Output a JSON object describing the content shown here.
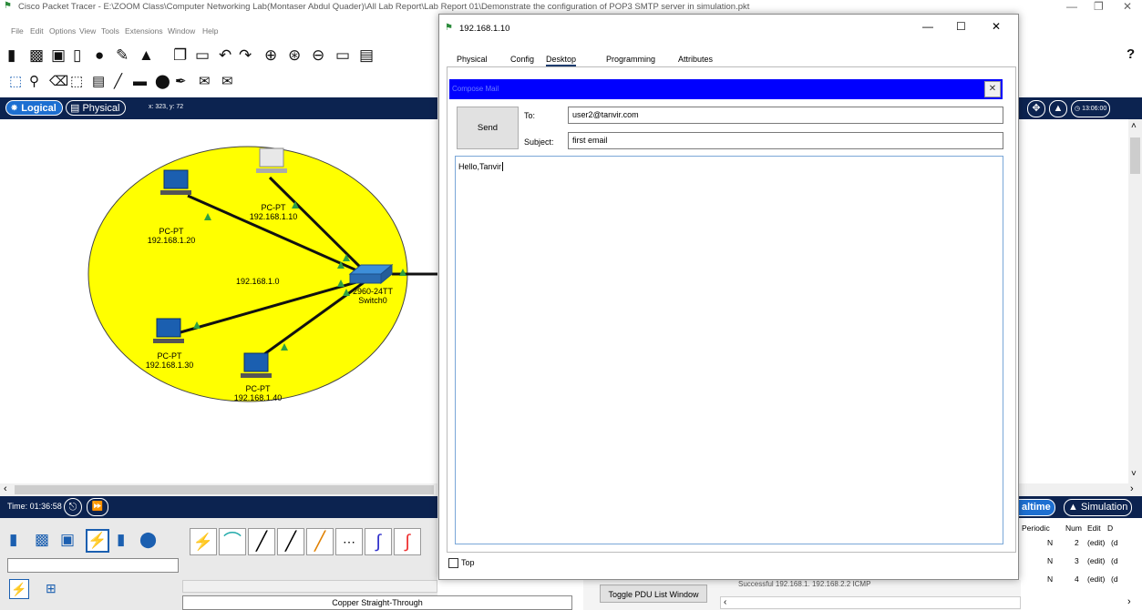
{
  "app": {
    "title": "Cisco Packet Tracer - E:\\ZOOM Class\\Computer Networking Lab(Montaser Abdul Quader)\\All Lab Report\\Lab Report 01\\Demonstrate the configuration of POP3 SMTP server in simulation.pkt",
    "menu": [
      "File",
      "Edit",
      "Options",
      "View",
      "Tools",
      "Extensions",
      "Window",
      "Help"
    ]
  },
  "workspace": {
    "logical_label": "Logical",
    "physical_label": "Physical",
    "coords": "x: 323, y: 72",
    "network_label": "192.168.1.0",
    "devices": [
      {
        "type": "PC-PT",
        "ip": "192.168.1.20"
      },
      {
        "type": "PC-PT",
        "ip": "192.168.1.10"
      },
      {
        "type": "PC-PT",
        "ip": "192.168.1.30"
      },
      {
        "type": "PC-PT",
        "ip": "192.168.1.40"
      }
    ],
    "switch": {
      "model": "2960-24TT",
      "name": "Switch0"
    },
    "clock": "13:06:00"
  },
  "timebar": {
    "time": "Time: 01:36:58"
  },
  "mode": {
    "realtime": "altime",
    "simulation": "Simulation"
  },
  "connections": {
    "selected_label": "Copper Straight-Through"
  },
  "pdu": {
    "toggle_label": "Toggle PDU List Window",
    "headers": [
      "Periodic",
      "Num",
      "Edit",
      "D"
    ],
    "rows": [
      {
        "periodic": "N",
        "num": "2",
        "edit": "(edit)",
        "d": "(d"
      },
      {
        "periodic": "N",
        "num": "3",
        "edit": "(edit)",
        "d": "(d"
      },
      {
        "periodic": "N",
        "num": "4",
        "edit": "(edit)",
        "d": "(d"
      }
    ],
    "partial_row": "Successful    192.168.1.    192.168.2.2    ICMP"
  },
  "dialog": {
    "title": "192.168.1.10",
    "tabs": [
      "Physical",
      "Config",
      "Desktop",
      "Programming",
      "Attributes"
    ],
    "active_tab": "Desktop",
    "compose_title": "Compose Mail",
    "send_label": "Send",
    "to_label": "To:",
    "to_value": "user2@tanvir.com",
    "subject_label": "Subject:",
    "subject_value": "first email",
    "body_value": "Hello,Tanvir",
    "top_label": "Top"
  },
  "colors": {
    "topbar": "#0c2350",
    "compose_header": "#0000ff",
    "lan_area": "#ffff00"
  }
}
